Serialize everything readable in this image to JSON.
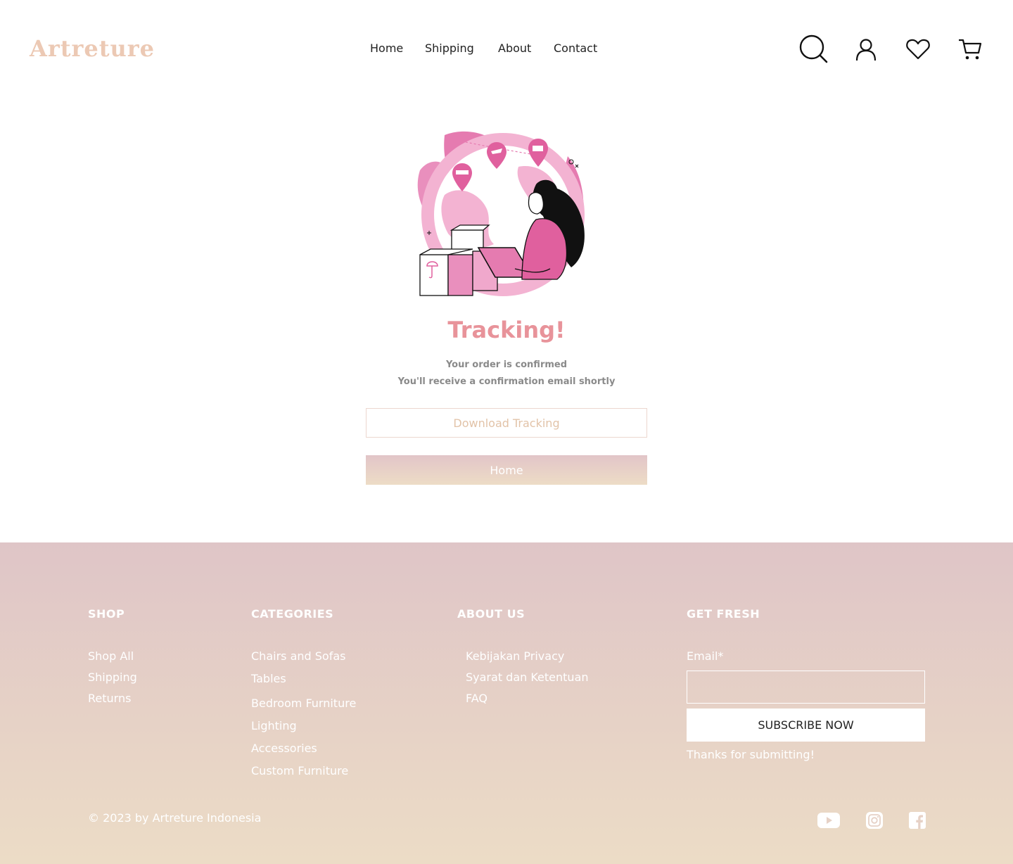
{
  "brand": {
    "logo_text": "Artreture"
  },
  "nav": {
    "items": [
      {
        "label": "Home"
      },
      {
        "label": "Shipping"
      },
      {
        "label": "About"
      },
      {
        "label": "Contact"
      }
    ]
  },
  "header_icons": [
    "search-icon",
    "user-icon",
    "heart-icon",
    "cart-icon"
  ],
  "hero": {
    "illustration": "delivery-tracking-illustration",
    "title": "Tracking!",
    "subtitle_line1": "Your order is confirmed",
    "subtitle_line2": "You'll receive a confirmation email shortly",
    "download_button": "Download Tracking",
    "home_button": "Home"
  },
  "footer": {
    "shop": {
      "heading": "SHOP",
      "links": [
        "Shop All",
        "Shipping",
        "Returns"
      ]
    },
    "categories": {
      "heading": "CATEGORIES",
      "links": [
        "Chairs and Sofas",
        "Tables",
        "Bedroom Furniture",
        "Lighting",
        "Accessories",
        "Custom Furniture"
      ]
    },
    "about": {
      "heading": "ABOUT US",
      "links": [
        "Kebijakan Privacy",
        "Syarat dan Ketentuan",
        "FAQ"
      ]
    },
    "newsletter": {
      "heading": "GET FRESH",
      "email_label": "Email*",
      "email_value": "",
      "subscribe_label": "SUBSCRIBE NOW",
      "thanks": "Thanks for submitting!"
    },
    "copyright": "© 2023 by Artreture Indonesia",
    "social": [
      "youtube-icon",
      "instagram-icon",
      "facebook-icon"
    ]
  },
  "colors": {
    "logo": "#ecc9b4",
    "title": "#e8939a",
    "illustration_pink": "#e57bb0",
    "footer_top": "#dfc5c7",
    "footer_bottom": "#ecdcc6"
  }
}
